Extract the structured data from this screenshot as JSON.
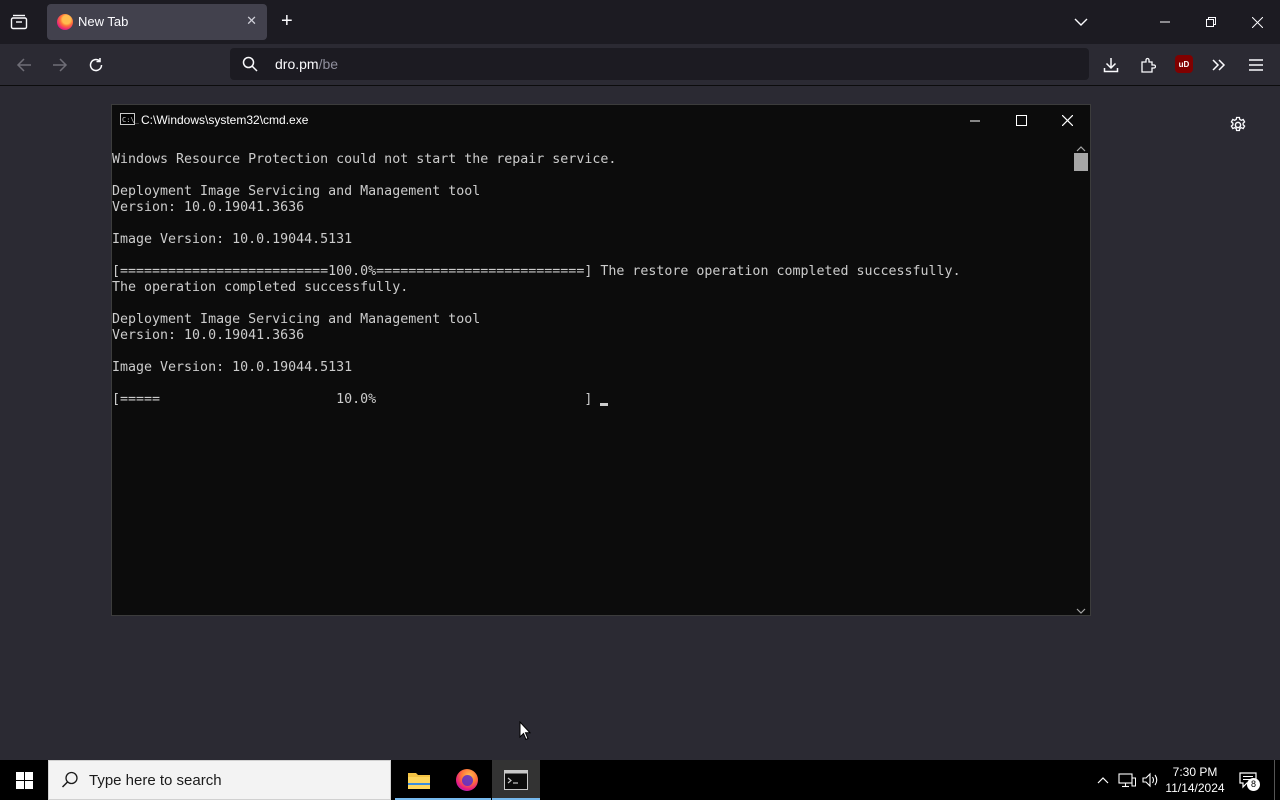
{
  "browser": {
    "tab": {
      "title": "New Tab",
      "close": "✕"
    },
    "new_tab": "+",
    "url_host": "dro.pm",
    "url_path": "/be",
    "ublock_label": "uD"
  },
  "cmd": {
    "title": "C:\\Windows\\system32\\cmd.exe",
    "icon_text": "C:\\_",
    "lines": [
      "Windows Resource Protection could not start the repair service.",
      "",
      "Deployment Image Servicing and Management tool",
      "Version: 10.0.19041.3636",
      "",
      "Image Version: 10.0.19044.5131",
      "",
      "[==========================100.0%==========================] The restore operation completed successfully.",
      "The operation completed successfully.",
      "",
      "Deployment Image Servicing and Management tool",
      "Version: 10.0.19041.3636",
      "",
      "Image Version: 10.0.19044.5131",
      "",
      "[=====                      10.0%                          ]"
    ]
  },
  "taskbar": {
    "search_placeholder": "Type here to search",
    "time": "7:30 PM",
    "date": "11/14/2024",
    "notification_count": "8"
  },
  "colors": {
    "browser_bg": "#2b2a33",
    "tabstrip_bg": "#1c1b22",
    "console_bg": "#0c0c0c",
    "console_text": "#cccccc",
    "taskbar_accent": "#76b9ed"
  }
}
